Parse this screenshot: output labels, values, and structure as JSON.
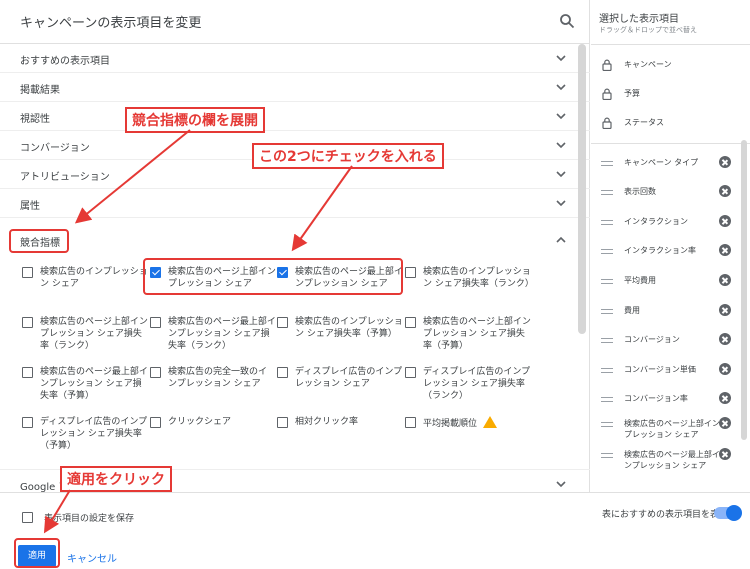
{
  "header": {
    "title": "キャンペーンの表示項目を変更"
  },
  "categories": [
    {
      "label": "おすすめの表示項目",
      "expanded": false
    },
    {
      "label": "掲載結果",
      "expanded": false
    },
    {
      "label": "視認性",
      "expanded": false
    },
    {
      "label": "コンバージョン",
      "expanded": false
    },
    {
      "label": "アトリビューション",
      "expanded": false
    },
    {
      "label": "属性",
      "expanded": false
    },
    {
      "label": "競合指標",
      "expanded": true
    }
  ],
  "competitive_options": [
    {
      "label": "検索広告のインプレッション シェア",
      "checked": false
    },
    {
      "label": "検索広告のページ上部インプレッション シェア",
      "checked": true
    },
    {
      "label": "検索広告のページ最上部インプレッション シェア",
      "checked": true
    },
    {
      "label": "検索広告のインプレッション シェア損失率（ランク）",
      "checked": false
    },
    {
      "label": "検索広告のページ上部インプレッション シェア損失率（ランク）",
      "checked": false
    },
    {
      "label": "検索広告のページ最上部インプレッション シェア損失率（ランク）",
      "checked": false
    },
    {
      "label": "検索広告のインプレッション シェア損失率（予算）",
      "checked": false
    },
    {
      "label": "検索広告のページ上部インプレッション シェア損失率（予算）",
      "checked": false
    },
    {
      "label": "検索広告のページ最上部インプレッション シェア損失率（予算）",
      "checked": false
    },
    {
      "label": "検索広告の完全一致のインプレッション シェア",
      "checked": false
    },
    {
      "label": "ディスプレイ広告のインプレッション シェア",
      "checked": false
    },
    {
      "label": "ディスプレイ広告のインプレッション シェア損失率（ランク）",
      "checked": false
    },
    {
      "label": "ディスプレイ広告のインプレッション シェア損失率（予算）",
      "checked": false
    },
    {
      "label": "クリックシェア",
      "checked": false
    },
    {
      "label": "相対クリック率",
      "checked": false
    },
    {
      "label": "平均掲載順位",
      "checked": false,
      "warning": true
    }
  ],
  "google_row": {
    "label": "Google ア"
  },
  "footer": {
    "save_label": "表示項目の設定を保存",
    "suggest_label": "表におすすめの表示項目を表示",
    "suggest_on": true,
    "apply_label": "適用",
    "cancel_label": "キャンセル"
  },
  "selected_panel": {
    "title": "選択した表示項目",
    "subtitle": "ドラッグ＆ドロップで並べ替え",
    "locked": [
      "キャンペーン",
      "予算",
      "ステータス"
    ],
    "items": [
      "キャンペーン タイプ",
      "表示回数",
      "インタラクション",
      "インタラクション率",
      "平均費用",
      "費用",
      "コンバージョン",
      "コンバージョン単価",
      "コンバージョン率",
      "検索広告のページ上部インプレッション シェア",
      "検索広告のページ最上部インプレッション シェア"
    ]
  },
  "annotations": {
    "expand": "競合指標の欄を展開",
    "check_two": "この2つにチェックを入れる",
    "click_apply": "適用をクリック"
  },
  "colors": {
    "accent": "#1a73e8",
    "annotation": "#e53935",
    "warning": "#f9ab00"
  }
}
